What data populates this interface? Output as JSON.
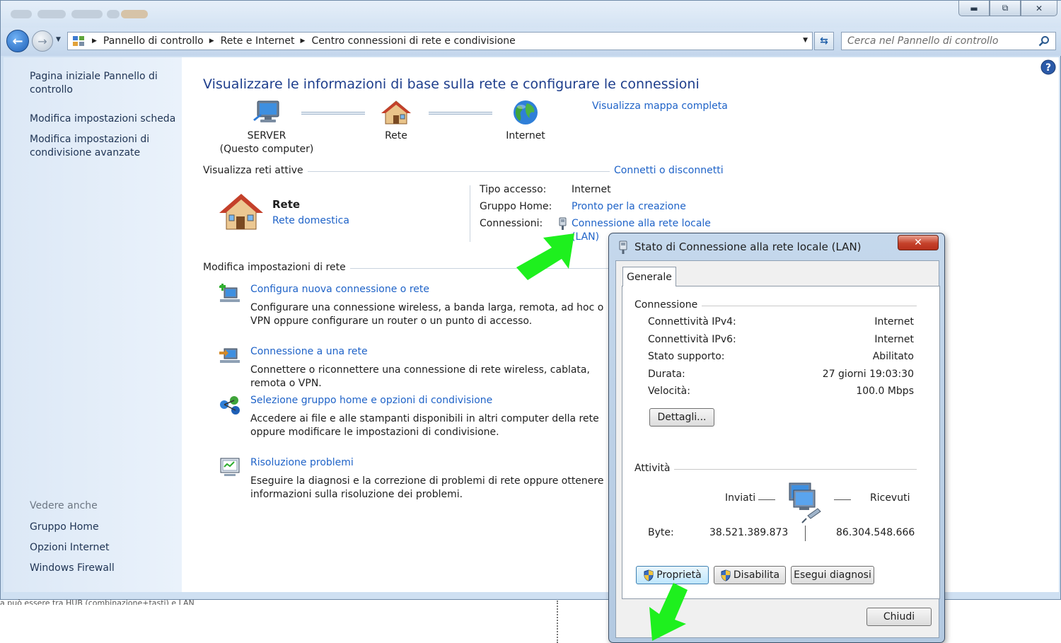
{
  "window": {
    "breadcrumb": [
      "Pannello di controllo",
      "Rete e Internet",
      "Centro connessioni di rete e condivisione"
    ],
    "search_placeholder": "Cerca nel Pannello di controllo"
  },
  "sidebar": {
    "links": [
      "Pagina iniziale Pannello di controllo",
      "Modifica impostazioni scheda",
      "Modifica impostazioni di condivisione avanzate"
    ],
    "see_also_heading": "Vedere anche",
    "see_also": [
      "Gruppo Home",
      "Opzioni Internet",
      "Windows Firewall"
    ]
  },
  "main": {
    "title": "Visualizzare le informazioni di base sulla rete e configurare le connessioni",
    "full_map_link": "Visualizza mappa completa",
    "nodes": {
      "computer_name": "SERVER",
      "computer_sub": "(Questo computer)",
      "network": "Rete",
      "internet": "Internet"
    },
    "active_networks_label": "Visualizza reti attive",
    "connect_link": "Connetti o disconnetti",
    "network_name": "Rete",
    "network_type": "Rete domestica",
    "access_type_label": "Tipo accesso:",
    "access_type_value": "Internet",
    "homegroup_label": "Gruppo Home:",
    "homegroup_value": "Pronto per la creazione",
    "connections_label": "Connessioni:",
    "connections_value_1": "Connessione alla rete locale",
    "connections_value_2": "(LAN)",
    "change_settings_label": "Modifica impostazioni di rete",
    "tasks": [
      {
        "title": "Configura nuova connessione o rete",
        "desc": "Configurare una connessione wireless, a banda larga, remota, ad hoc o VPN oppure configurare un router o un punto di accesso."
      },
      {
        "title": "Connessione a una rete",
        "desc": "Connettere o riconnettere una connessione di rete wireless, cablata, remota o VPN."
      },
      {
        "title": "Selezione gruppo home e opzioni di condivisione",
        "desc": "Accedere ai file e alle stampanti disponibili in altri computer della rete oppure modificare le impostazioni di condivisione."
      },
      {
        "title": "Risoluzione problemi",
        "desc": "Eseguire la diagnosi e la correzione di problemi di rete oppure ottenere informazioni sulla risoluzione dei problemi."
      }
    ]
  },
  "below": {
    "text": "a può essere tra HUB (combinazione+tasti) e LAN"
  },
  "dialog": {
    "title": "Stato di Connessione alla rete locale (LAN)",
    "tab": "Generale",
    "connection_group": "Connessione",
    "rows": [
      {
        "label": "Connettività IPv4:",
        "value": "Internet"
      },
      {
        "label": "Connettività IPv6:",
        "value": "Internet"
      },
      {
        "label": "Stato supporto:",
        "value": "Abilitato"
      },
      {
        "label": "Durata:",
        "value": "27 giorni 19:03:30"
      },
      {
        "label": "Velocità:",
        "value": "100.0 Mbps"
      }
    ],
    "details_button": "Dettagli...",
    "activity_group": "Attività",
    "sent_label": "Inviati",
    "received_label": "Ricevuti",
    "bytes_label": "Byte:",
    "bytes_sent": "38.521.389.873",
    "bytes_received": "86.304.548.666",
    "properties_button": "Proprietà",
    "disable_button": "Disabilita",
    "diagnose_button": "Esegui diagnosi",
    "close_button": "Chiudi"
  },
  "colors": {
    "link": "#1f63c8",
    "title": "#1e3e8c",
    "annotation_arrow": "#1ef01e",
    "close_button": "#c5412a"
  },
  "icons": [
    "back-arrow-icon",
    "forward-arrow-icon",
    "control-panel-icon",
    "refresh-icon",
    "search-icon",
    "help-icon",
    "computer-icon",
    "house-icon",
    "globe-icon",
    "ethernet-plug-icon",
    "shield-icon",
    "network-computers-icon"
  ]
}
